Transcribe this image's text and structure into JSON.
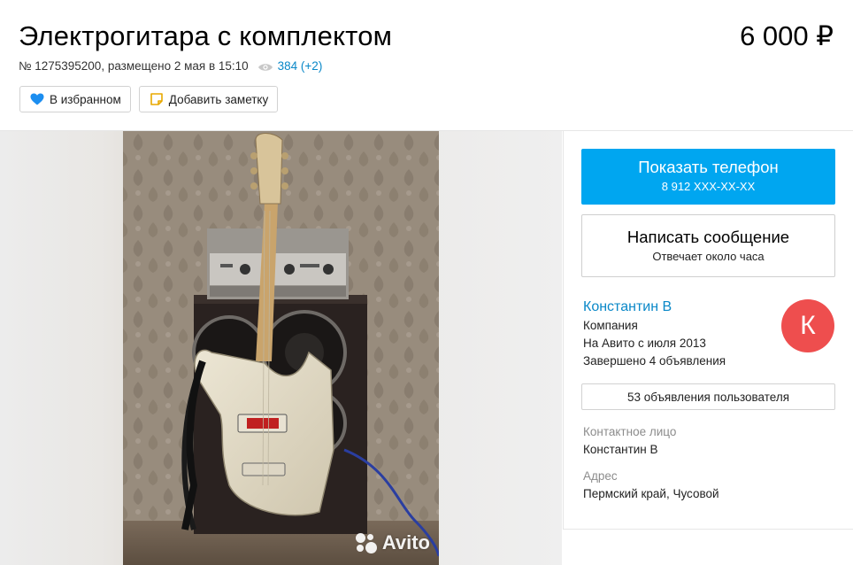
{
  "listing": {
    "title": "Электрогитара с комплектом",
    "price": "6 000 ₽",
    "meta_text": "№ 1275395200, размещено 2 мая в 15:10",
    "views": "384 (+2)",
    "favorite_label": "В избранном",
    "note_label": "Добавить заметку"
  },
  "gallery": {
    "watermark": "Avito"
  },
  "sidebar": {
    "phone_button": "Показать телефон",
    "phone_number": "8 912 XXX-XX-XX",
    "message_button": "Написать сообщение",
    "message_sub": "Отвечает около часа",
    "seller_name": "Константин В",
    "seller_type": "Компания",
    "seller_since": "На Авито с июля 2013",
    "seller_completed": "Завершено 4 объявления",
    "avatar_letter": "К",
    "user_ads_button": "53 объявления пользователя",
    "contact_label": "Контактное лицо",
    "contact_value": "Константин В",
    "address_label": "Адрес",
    "address_value": "Пермский край, Чусовой"
  },
  "colors": {
    "accent_blue": "#00a6f0",
    "link_blue": "#0a88c8",
    "avatar_red": "#ee4e4e",
    "heart_blue": "#1c8ef0"
  },
  "icons": {
    "views": "eye-icon",
    "favorite": "heart-icon",
    "note": "note-icon",
    "watermark": "avito-logo-icon"
  }
}
